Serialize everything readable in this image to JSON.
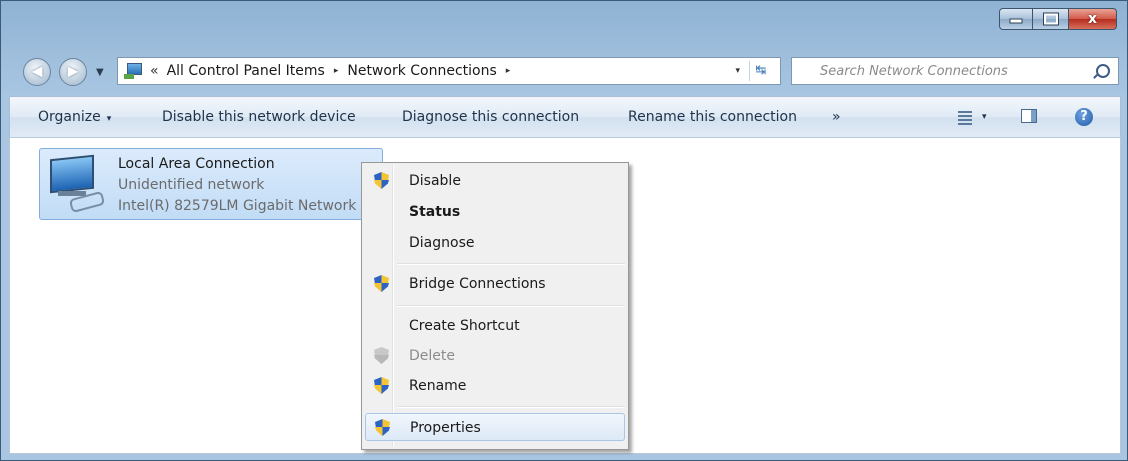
{
  "window": {
    "caption_buttons": [
      {
        "name": "minimize",
        "icon": "minimize-icon"
      },
      {
        "name": "maximize",
        "icon": "maximize-icon"
      },
      {
        "name": "close",
        "icon": "close-icon",
        "glyph": "x"
      }
    ]
  },
  "navigation": {
    "back_icon": "back-arrow-icon",
    "forward_icon": "forward-arrow-icon",
    "recent_icon": "chevron-down-icon"
  },
  "address_bar": {
    "icon": "control-panel-icon",
    "overflow_glyph": "«",
    "breadcrumbs": [
      "All Control Panel Items",
      "Network Connections"
    ],
    "separator_glyph": "▸",
    "dropdown_glyph": "▾",
    "refresh_icon": "refresh-icon",
    "refresh_glyph": "↹"
  },
  "search": {
    "placeholder": "Search Network Connections",
    "icon": "search-icon"
  },
  "command_bar": {
    "organize_label": "Organize",
    "dropdown_glyph": "▾",
    "items": [
      "Disable this network device",
      "Diagnose this connection",
      "Rename this connection"
    ],
    "overflow_glyph": "»",
    "views_icon": "views-icon",
    "preview_icon": "preview-pane-icon",
    "help_icon": "help-icon",
    "help_glyph": "?"
  },
  "connection": {
    "name": "Local Area Connection",
    "status": "Unidentified network",
    "adapter": "Intel(R) 82579LM Gigabit Network Connection",
    "icon": "network-adapter-icon",
    "selected": true
  },
  "context_menu": {
    "items": [
      {
        "label": "Disable",
        "shield": true
      },
      {
        "label": "Status",
        "bold": true
      },
      {
        "label": "Diagnose"
      },
      {
        "label": "Bridge Connections",
        "shield": true
      },
      {
        "label": "Create Shortcut"
      },
      {
        "label": "Delete",
        "shield": true,
        "disabled": true
      },
      {
        "label": "Rename",
        "shield": true
      },
      {
        "label": "Properties",
        "shield": true,
        "highlighted": true
      }
    ]
  },
  "colors": {
    "window_frame": "#9dbddb",
    "selection": "#c9e0f7",
    "menu_background": "#f0f0f0",
    "shield_blue": "#2d64c3",
    "shield_yellow": "#f3c534"
  }
}
